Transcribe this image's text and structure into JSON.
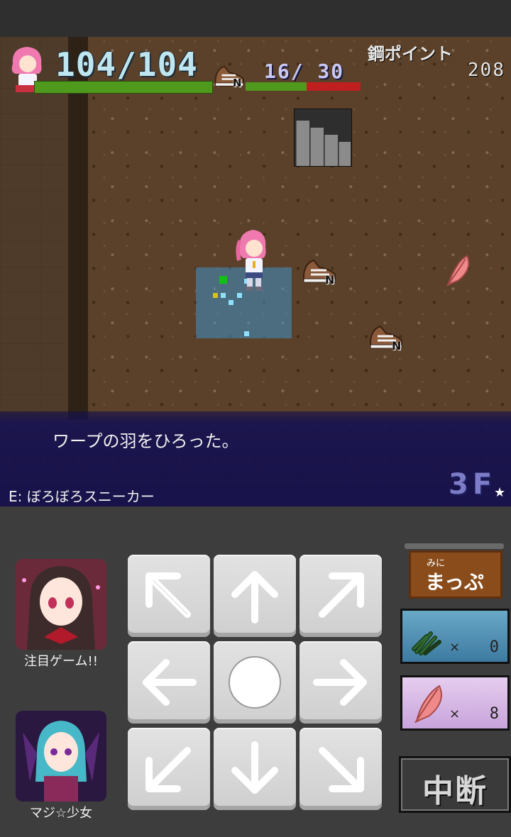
{
  "hud": {
    "hp_text": "104/104",
    "hp_fraction": 1.0,
    "pp_text": "16/ 30",
    "pp_fraction": 0.533,
    "steel_points_label": "鋼ポイント",
    "steel_points_value": "208",
    "equip_badge": "N"
  },
  "map": {
    "item_badge": "N"
  },
  "message": {
    "text": "ワープの羽をひろった。",
    "equipped": "E: ぼろぼろスニーカー"
  },
  "floor": {
    "label": "3F",
    "star": "★"
  },
  "controls": {
    "dpad": [
      "up-left",
      "up",
      "up-right",
      "left",
      "wait",
      "right",
      "down-left",
      "down",
      "down-right"
    ],
    "minimap_button": {
      "small": "みに",
      "big": "まっぷ"
    },
    "inventory": [
      {
        "name": "grass",
        "count": "0",
        "times": "×"
      },
      {
        "name": "feather",
        "count": "8",
        "times": "×"
      }
    ],
    "suspend_label": "中断"
  },
  "ads": [
    {
      "label": "注目ゲーム!!"
    },
    {
      "label": "マジ☆少女"
    }
  ],
  "colors": {
    "hp_green": "#4f9a1d",
    "pp_red": "#bf1f1f",
    "message_bg": "#16124f",
    "floor_text": "#7c7cc8"
  }
}
